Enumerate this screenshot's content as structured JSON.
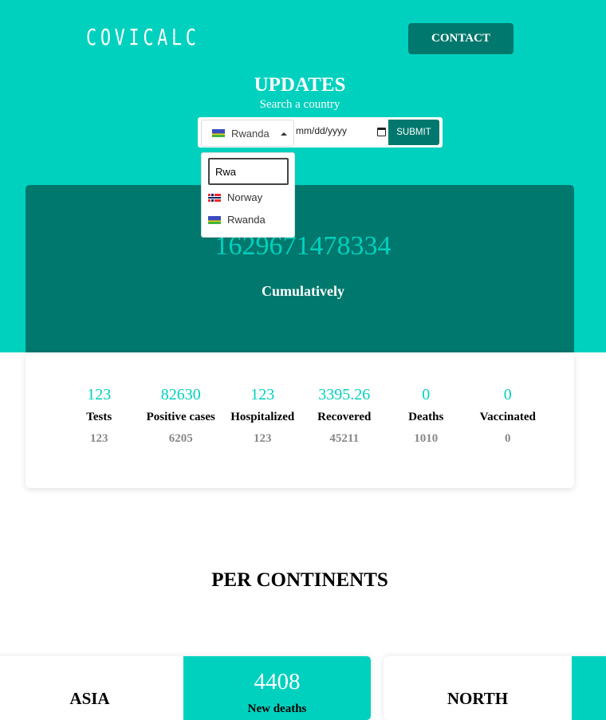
{
  "header": {
    "logo": "COVICALC",
    "contact_label": "CONTACT"
  },
  "updates": {
    "title": "UPDATES",
    "subtitle": "Search a country",
    "selected_country": "Rwanda",
    "date_placeholder": "mm/dd/yyyy",
    "submit_label": "SUBMIT"
  },
  "dropdown": {
    "search_value": "Rwa",
    "options": [
      {
        "label": "Norway",
        "flag": "norway-flag"
      },
      {
        "label": "Rwanda",
        "flag": "rwanda-flag"
      }
    ]
  },
  "summary": {
    "value": "1629671478334",
    "label": "Cumulatively"
  },
  "stats": [
    {
      "value": "123",
      "label": "Tests",
      "sub": "123"
    },
    {
      "value": "82630",
      "label": "Positive cases",
      "sub": "6205"
    },
    {
      "value": "123",
      "label": "Hospitalized",
      "sub": "123"
    },
    {
      "value": "3395.26",
      "label": "Recovered",
      "sub": "45211"
    },
    {
      "value": "0",
      "label": "Deaths",
      "sub": "1010"
    },
    {
      "value": "0",
      "label": "Vaccinated",
      "sub": "0"
    }
  ],
  "continents": {
    "title": "PER CONTINENTS",
    "cards": [
      {
        "name": "ASIA",
        "value": "4408",
        "label": "New deaths"
      },
      {
        "name": "NORTH"
      }
    ]
  },
  "colors": {
    "primary": "#00d1be",
    "dark": "#00786d"
  }
}
